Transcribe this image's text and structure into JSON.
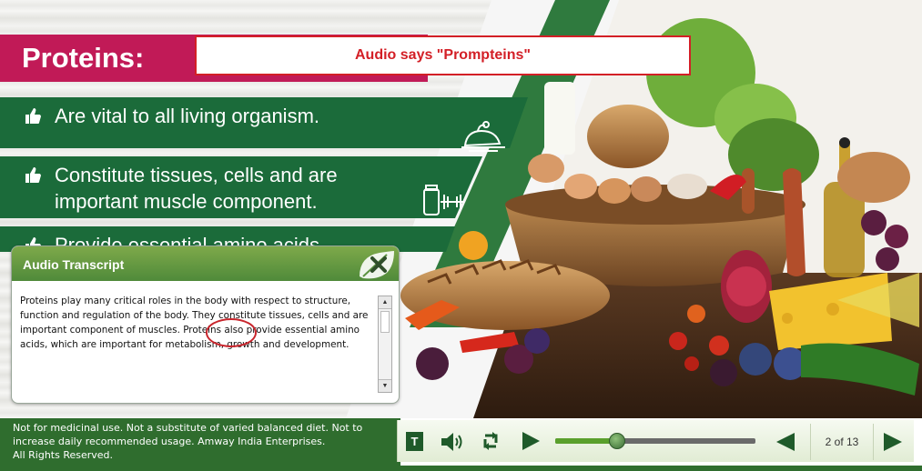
{
  "slide": {
    "title": "Proteins:",
    "note": "Audio says \"Prompteins\"",
    "bullets": [
      {
        "line1": "Are vital to all living organism.",
        "line2": ""
      },
      {
        "line1": "Constitute tissues, cells and are",
        "line2": "important muscle component."
      },
      {
        "line1": "Provide essential amino acids",
        "line2": ""
      }
    ],
    "icons": [
      "roast-chicken-icon",
      "supplement-dumbbell-icon"
    ]
  },
  "transcript": {
    "title": "Audio Transcript",
    "text_before": "Proteins play many critical roles in the body with respect to structure, function and regulation of the body. They constitute tissues, cells and are important component of muscles. ",
    "highlight": "Proteins",
    "text_after": " also provide essential amino acids, which are important for metabolism, growth and development."
  },
  "footer": {
    "disclaimer_lines": [
      "Not for medicinal use. Not a substitute of varied balanced diet. Not to",
      "increase daily recommended usage. Amway India Enterprises.",
      "All Rights Reserved."
    ],
    "transcript_toggle_label": "T",
    "page_indicator": "2 of 13",
    "seek_progress": 0.31
  },
  "colors": {
    "title_band": "#c11a57",
    "bullet_band": "#1b6b3a",
    "accent_red": "#d31f26",
    "footer_green": "#2f6d2e"
  }
}
